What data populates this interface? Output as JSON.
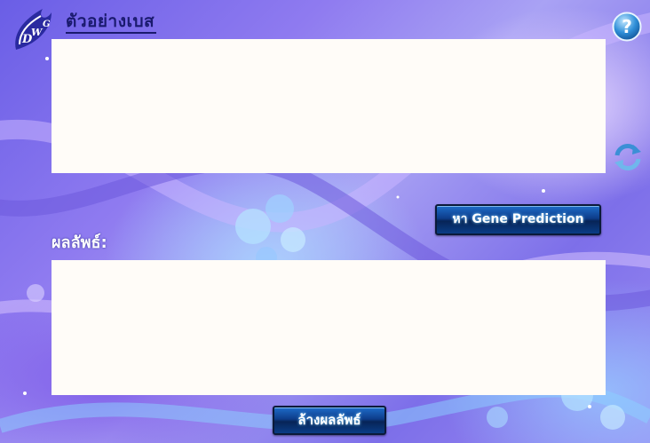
{
  "header": {
    "title": "ตัวอย่างเบส",
    "logo_icon": "dwg-logo-icon",
    "help_icon": "help-question-icon"
  },
  "input": {
    "value": ""
  },
  "refresh": {
    "icon": "refresh-icon"
  },
  "actions": {
    "predict_label": "หา Gene Prediction",
    "clear_label": "ล้างผลลัพธ์"
  },
  "result": {
    "label": "ผลลัพธ์:",
    "value": ""
  },
  "colors": {
    "title": "#1a1a6e",
    "button": "#0d3c8a",
    "box": "#fffcf8"
  }
}
